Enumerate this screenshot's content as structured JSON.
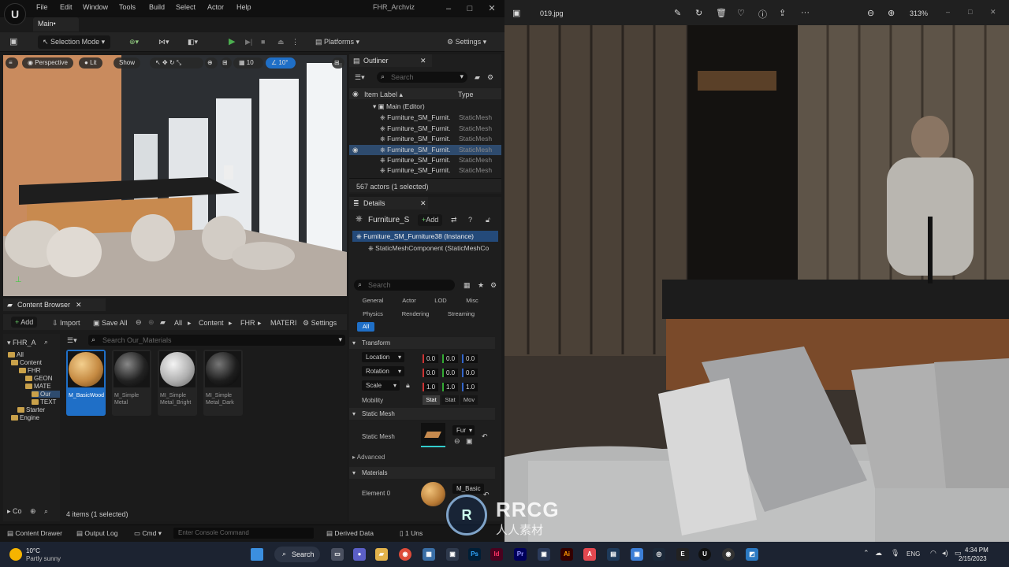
{
  "window": {
    "title": "FHR_Archviz",
    "main_tab": "Main•"
  },
  "menu": [
    "File",
    "Edit",
    "Window",
    "Tools",
    "Build",
    "Select",
    "Actor",
    "Help"
  ],
  "toolbar": {
    "selection_mode": "Selection Mode",
    "platforms": "Platforms",
    "settings": "Settings"
  },
  "viewport": {
    "perspective": "Perspective",
    "lit": "Lit",
    "show": "Show",
    "grid": "10",
    "angle": "10°"
  },
  "outliner": {
    "tab": "Outliner",
    "search_placeholder": "Search",
    "col_label": "Item Label ▴",
    "col_type": "Type",
    "root": "Main (Editor)",
    "rows": [
      {
        "label": "Furniture_SM_Furnit.",
        "type": "StaticMesh"
      },
      {
        "label": "Furniture_SM_Furnit.",
        "type": "StaticMesh"
      },
      {
        "label": "Furniture_SM_Furnit.",
        "type": "StaticMesh"
      },
      {
        "label": "Furniture_SM_Furnit.",
        "type": "StaticMesh"
      },
      {
        "label": "Furniture_SM_Furnit.",
        "type": "StaticMesh"
      },
      {
        "label": "Furniture_SM_Furnit.",
        "type": "StaticMesh"
      }
    ],
    "status": "567 actors (1 selected)"
  },
  "details": {
    "tab": "Details",
    "actor_name": "Furniture_S",
    "add": "Add",
    "instance": "Furniture_SM_Furniture38 (Instance)",
    "component": "StaticMeshComponent (StaticMeshCo",
    "search_placeholder": "Search",
    "filters": [
      "General",
      "Actor",
      "LOD",
      "Misc",
      "Physics",
      "Rendering",
      "Streaming",
      "All"
    ],
    "transform_header": "Transform",
    "location": "Location",
    "rotation": "Rotation",
    "scale": "Scale",
    "loc_vals": [
      "0.0",
      "0.0",
      "0.0"
    ],
    "rot_vals": [
      "0.0",
      "0.0",
      "0.0"
    ],
    "scale_vals": [
      "1.0",
      "1.0",
      "1.0"
    ],
    "mobility": "Mobility",
    "mobility_opts": [
      "Stat",
      "Stat",
      "Mov"
    ],
    "static_mesh_header": "Static Mesh",
    "static_mesh_label": "Static Mesh",
    "static_mesh_value": "Fur",
    "advanced": "Advanced",
    "materials_header": "Materials",
    "element0": "Element 0",
    "element0_value": "M_Basic"
  },
  "content_browser": {
    "tab": "Content Browser",
    "add": "Add",
    "import": "Import",
    "save_all": "Save All",
    "path": [
      "All",
      "Content",
      "FHR",
      "MATERI"
    ],
    "settings": "Settings",
    "tree_root": "FHR_A",
    "search_placeholder": "Search Our_Materials",
    "tree": [
      "All",
      "Content",
      "FHR",
      "GEON",
      "MATE",
      "Our",
      "TEXT",
      "Starter",
      "Engine"
    ],
    "assets": [
      {
        "name": "M_BasicWood"
      },
      {
        "name": "M_Simple Metal"
      },
      {
        "name": "MI_Simple Metal_Bright"
      },
      {
        "name": "MI_Simple Metal_Dark"
      }
    ],
    "bottom_left": "Co",
    "status": "4 items (1 selected)"
  },
  "statusbar": {
    "content_drawer": "Content Drawer",
    "output_log": "Output Log",
    "cmd": "Cmd",
    "console_placeholder": "Enter Console Command",
    "derived_data": "Derived Data",
    "unsaved": "1 Uns"
  },
  "photos": {
    "filename": "019.jpg",
    "zoom": "313%"
  },
  "taskbar": {
    "weather_temp": "10°C",
    "weather_desc": "Partly sunny",
    "search": "Search",
    "lang": "ENG",
    "time": "4:34 PM",
    "date": "2/15/2023"
  },
  "watermark": {
    "brand": "RRCG",
    "sub": "人人素材"
  }
}
